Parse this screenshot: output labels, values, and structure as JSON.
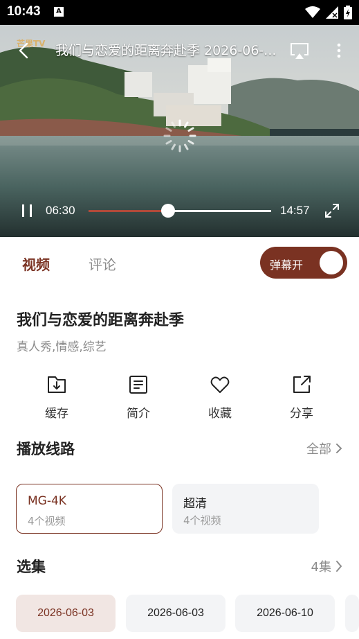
{
  "status_bar": {
    "time": "10:43",
    "notif_letter": "A"
  },
  "player": {
    "brand": "芒果TV",
    "title": "我们与恋爱的距离奔赴季 2026-06-...",
    "current_time": "06:30",
    "duration": "14:57",
    "progress": 0.434,
    "state": "buffering"
  },
  "tabs": [
    {
      "label": "视频",
      "active": true
    },
    {
      "label": "评论",
      "active": false
    }
  ],
  "danmu_toggle": {
    "label": "弹幕开",
    "on": true
  },
  "show": {
    "title": "我们与恋爱的距离奔赴季",
    "tags": "真人秀,情感,综艺"
  },
  "actions": [
    {
      "label": "缓存",
      "icon": "download-icon"
    },
    {
      "label": "简介",
      "icon": "document-icon"
    },
    {
      "label": "收藏",
      "icon": "heart-icon"
    },
    {
      "label": "分享",
      "icon": "share-icon"
    }
  ],
  "routes_section": {
    "title": "播放线路",
    "more": "全部",
    "routes": [
      {
        "name": "MG-4K",
        "count": "4个视频",
        "active": true
      },
      {
        "name": "超清",
        "count": "4个视频",
        "active": false
      }
    ]
  },
  "episodes_section": {
    "title": "选集",
    "more": "4集",
    "episodes": [
      {
        "label": "2026-06-03",
        "active": true
      },
      {
        "label": "2026-06-03",
        "active": false
      },
      {
        "label": "2026-06-10",
        "active": false
      }
    ]
  },
  "colors": {
    "accent": "#7a3222",
    "accent_light": "#f1e6e3",
    "progress": "#b14a3a"
  }
}
